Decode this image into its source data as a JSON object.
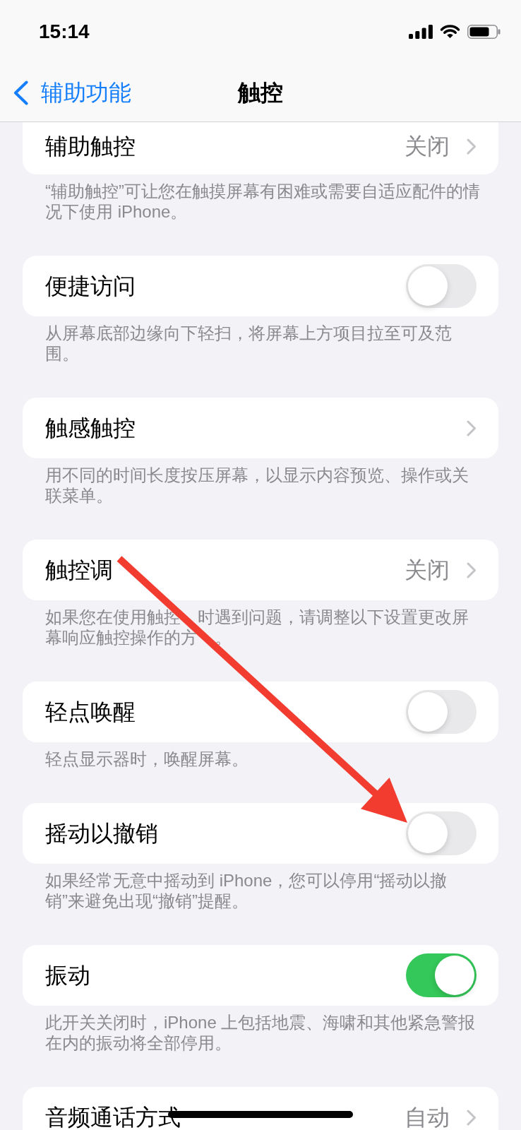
{
  "status_bar": {
    "time": "15:14"
  },
  "nav_bar": {
    "back_label": "辅助功能",
    "title": "触控"
  },
  "sections": [
    {
      "kind": "link",
      "label": "辅助触控",
      "value": "关闭",
      "pointed_at": false,
      "footer": "“辅助触控”可让您在触摸屏幕有困难或需要自适应配件的情况下使用 iPhone。"
    },
    {
      "kind": "toggle",
      "label": "便捷访问",
      "on": false,
      "pointed_at": false,
      "footer": "从屏幕底部边缘向下轻扫，将屏幕上方项目拉至可及范围。"
    },
    {
      "kind": "link",
      "label": "触感触控",
      "pointed_at": false,
      "footer": "用不同的时间长度按压屏幕，以显示内容预览、操作或关联菜单。"
    },
    {
      "kind": "link",
      "label": "触控调",
      "value": "关闭",
      "pointed_at": false,
      "footer": "如果您在使用触控　时遇到问题，请调整以下设置更改屏幕响应触控操作的方　。"
    },
    {
      "kind": "toggle",
      "label": "轻点唤醒",
      "on": false,
      "pointed_at": false,
      "footer": "轻点显示器时，唤醒屏幕。"
    },
    {
      "kind": "toggle",
      "label": "摇动以撤销",
      "on": false,
      "pointed_at": true,
      "footer": "如果经常无意中摇动到 iPhone，您可以停用“摇动以撤销”来避免出现“撤销”提醒。"
    },
    {
      "kind": "toggle",
      "label": "振动",
      "on": true,
      "pointed_at": false,
      "footer": "此开关关闭时，iPhone 上包括地震、海啸和其他紧急警报在内的振动将全部停用。"
    },
    {
      "kind": "link",
      "label": "音频通话方式",
      "value": "自动",
      "pointed_at": false
    }
  ]
}
